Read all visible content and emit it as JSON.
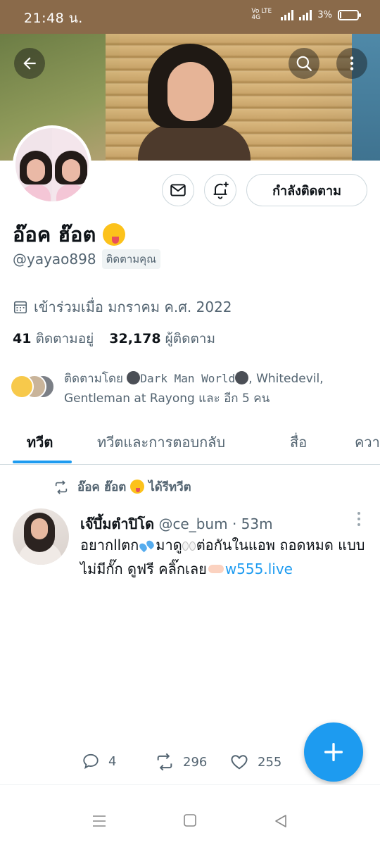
{
  "status_bar": {
    "time": "21:48 น.",
    "network": "Vo LTE 4G",
    "battery": "3%",
    "battery_level": 0.03,
    "bg_color": "#8a6a4a"
  },
  "banner": {
    "back_icon": "arrow-left-icon",
    "search_icon": "search-icon",
    "more_icon": "more-vertical-icon"
  },
  "profile": {
    "display_name": "อ๊อค ฮ๊อต",
    "name_emoji": "squinting-face-with-tongue",
    "handle": "@yayao898",
    "follows_you": "ติดตามคุณ",
    "joined": "เข้าร่วมเมื่อ มกราคม ค.ศ. 2022",
    "following_count": "41",
    "following_label": "ติดตามอยู่",
    "followers_count": "32,178",
    "followers_label": "ผู้ติดตาม",
    "followed_by_prefix": "ติดตามโดย",
    "followed_by_name1": "Dark Man World",
    "followed_by_rest": ", Whitedevil, Gentleman at Rayong และ อีก 5 คน"
  },
  "buttons": {
    "message_icon": "mail-icon",
    "notify_icon": "bell-plus-icon",
    "following_label": "กำลังติดตาม"
  },
  "tabs": [
    {
      "label": "ทวีต",
      "active": true
    },
    {
      "label": "ทวีตและการตอบกลับ",
      "active": false
    },
    {
      "label": "สื่อ",
      "active": false
    },
    {
      "label": "ควา",
      "active": false
    }
  ],
  "tweet": {
    "retweet_by": "อ๊อค ฮ๊อต",
    "retweet_suffix": "ได้รีทวีต",
    "author_name": "เจ๊บึ้มตำปิโด",
    "author_meta": "@ce_bum · 53m",
    "text_part1": "อยากllตก",
    "text_part2": "มาดู",
    "text_part3": "ต่อกันในแอพ ถอดหมด แบบไม่มีกั๊ก ดูฟรี คลิ๊กเลย",
    "link": "w555.live",
    "replies": "4",
    "retweets": "296",
    "likes": "255"
  },
  "fab": {
    "icon": "plus-icon"
  },
  "nav": {
    "menu_icon": "menu-icon",
    "home_icon": "square-icon",
    "back_icon": "triangle-back-icon"
  },
  "colors": {
    "accent": "#1d9bf0",
    "text": "#0f1419",
    "secondary": "#536471",
    "border": "#cfd9de"
  }
}
